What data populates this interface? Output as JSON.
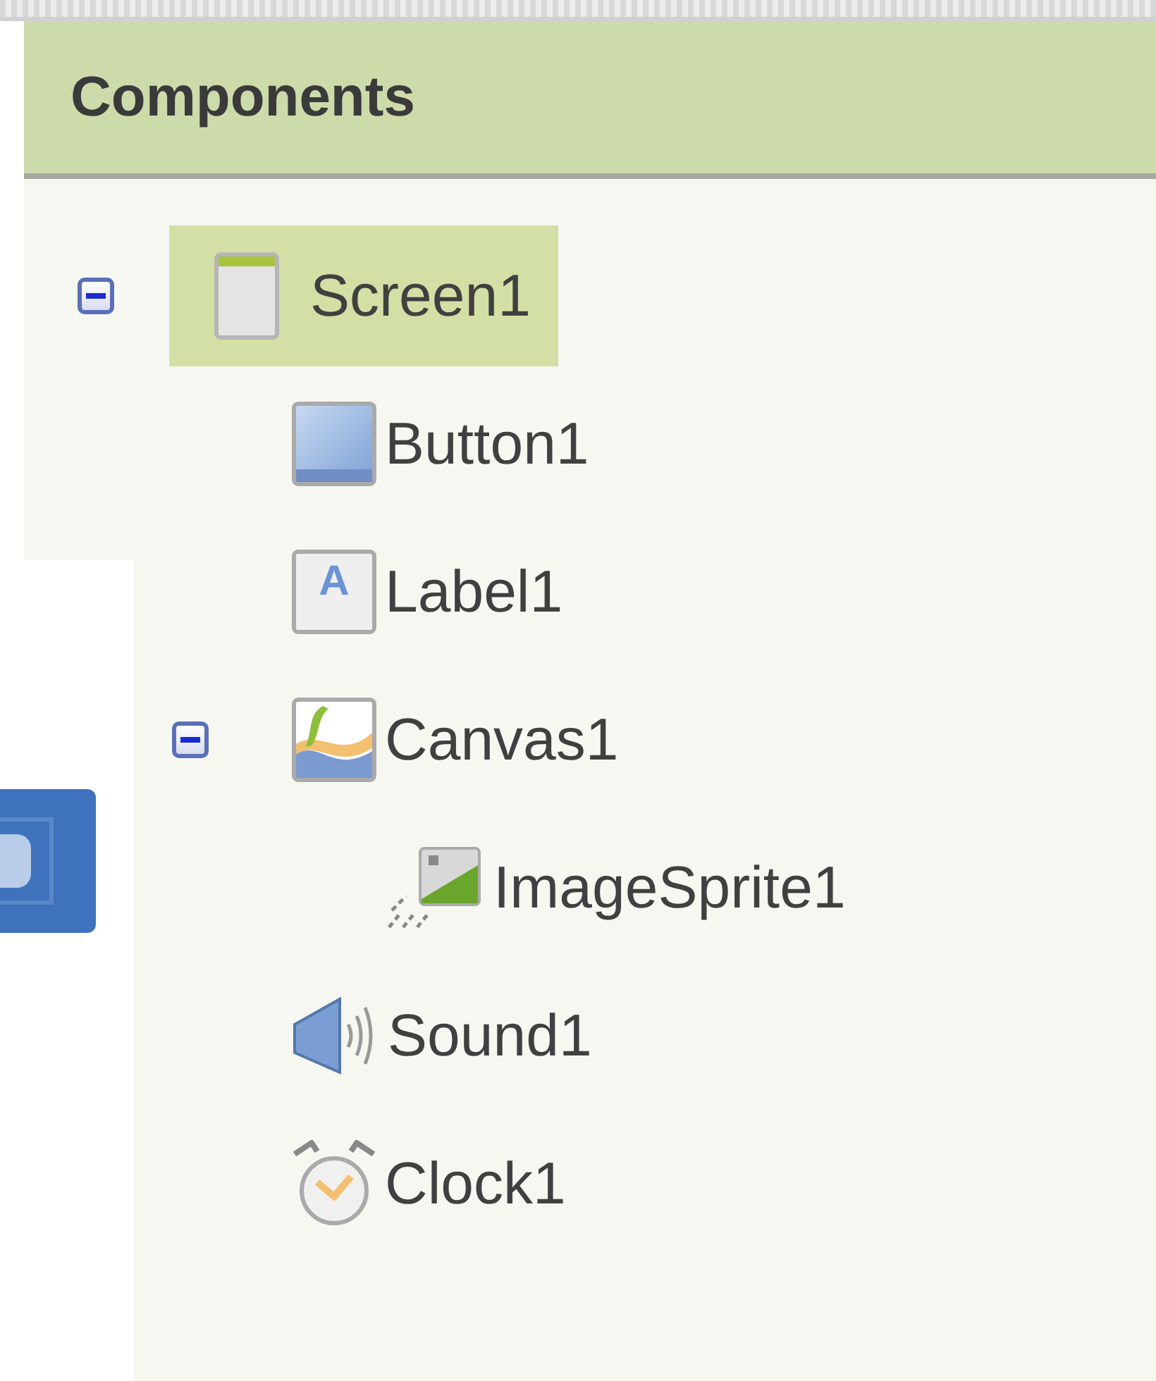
{
  "panel": {
    "title": "Components"
  },
  "tree": [
    {
      "label": "Screen1",
      "kind": "screen",
      "selected": true,
      "expanded": true,
      "children": [
        {
          "label": "Button1",
          "kind": "button",
          "selected": false
        },
        {
          "label": "Label1",
          "kind": "label",
          "glyph": "A",
          "selected": false
        },
        {
          "label": "Canvas1",
          "kind": "canvas",
          "selected": false,
          "expanded": true,
          "children": [
            {
              "label": "ImageSprite1",
              "kind": "sprite",
              "selected": false
            }
          ]
        },
        {
          "label": "Sound1",
          "kind": "sound",
          "selected": false
        },
        {
          "label": "Clock1",
          "kind": "clock",
          "selected": false
        }
      ]
    }
  ]
}
